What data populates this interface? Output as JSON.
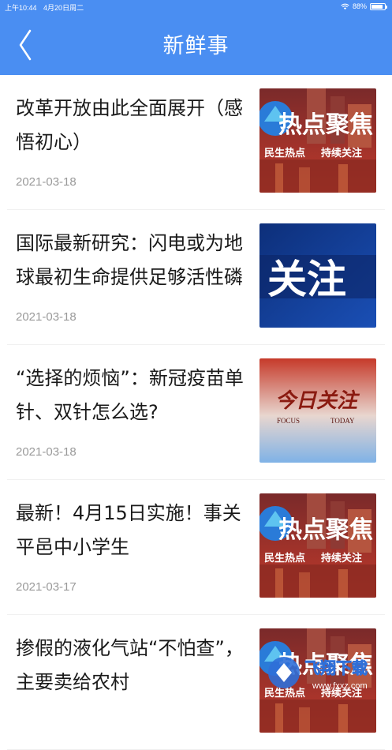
{
  "status": {
    "time": "上午10:44",
    "date": "4月20日周二",
    "battery": "88%",
    "battery_level": 0.88
  },
  "header": {
    "title": "新鲜事",
    "back_icon": "chevron-left-icon"
  },
  "articles": [
    {
      "title": "改革开放由此全面展开（感悟初心）",
      "date": "2021-03-18",
      "thumb": "hot-focus",
      "thumb_text": "热点聚焦",
      "thumb_sub1": "民生热点",
      "thumb_sub2": "持续关注"
    },
    {
      "title": "国际最新研究：闪电或为地球最初生命提供足够活性磷",
      "date": "2021-03-18",
      "thumb": "attention",
      "thumb_text": "关注"
    },
    {
      "title": "“选择的烦恼”：新冠疫苗单针、双针怎么选?",
      "date": "2021-03-18",
      "thumb": "focus-today",
      "thumb_text": "今日关注",
      "thumb_sub1": "FOCUS",
      "thumb_sub2": "TODAY"
    },
    {
      "title": "最新！4月15日实施！事关平邑中小学生",
      "date": "2021-03-17",
      "thumb": "hot-focus",
      "thumb_text": "热点聚焦",
      "thumb_sub1": "民生热点",
      "thumb_sub2": "持续关注"
    },
    {
      "title": "掺假的液化气站“不怕查”，主要卖给农村",
      "date": "",
      "thumb": "hot-focus",
      "thumb_text": "热点聚焦",
      "thumb_sub1": "民生热点",
      "thumb_sub2": "持续关注"
    }
  ],
  "watermark": {
    "text": "飞翔下载",
    "url": "www.fxxz.com"
  },
  "colors": {
    "header": "#4a8ef2",
    "title_text": "#1a1a1a",
    "date_text": "#9a9a9a"
  }
}
